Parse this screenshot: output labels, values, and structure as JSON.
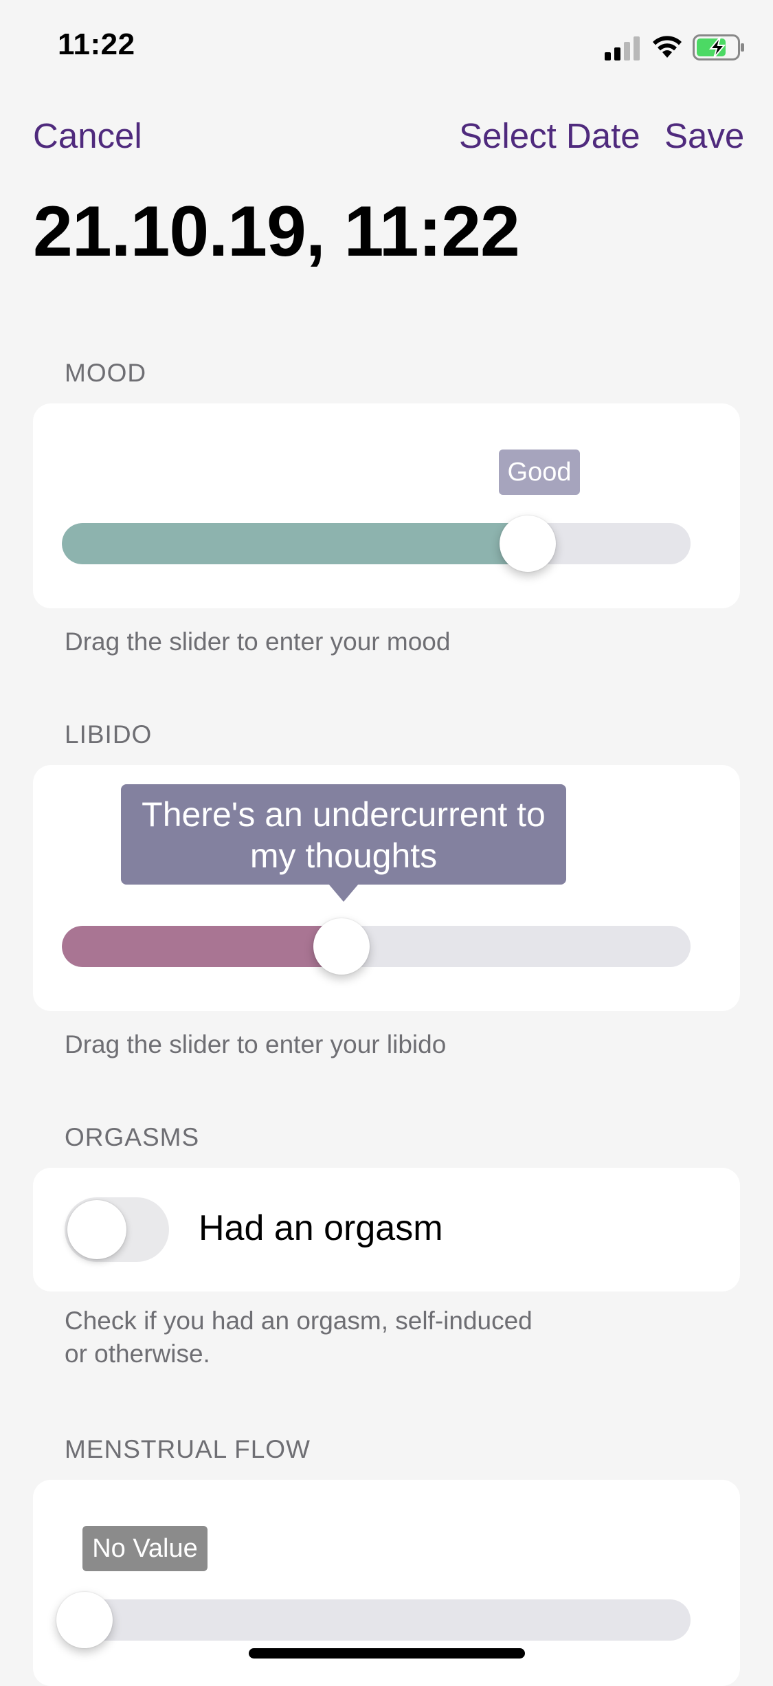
{
  "status_bar": {
    "time": "11:22"
  },
  "nav": {
    "cancel": "Cancel",
    "select_date": "Select Date",
    "save": "Save"
  },
  "entry": {
    "datetime": "21.10.19, 11:22"
  },
  "mood": {
    "section": "MOOD",
    "value_label": "Good",
    "level": 0.76,
    "fill_color": "#8db3ae",
    "help": "Drag the slider to enter your mood"
  },
  "libido": {
    "section": "LIBIDO",
    "value_label_line1": "There's an undercurrent to",
    "value_label_line2": "my thoughts",
    "level": 0.44,
    "fill_color": "#a97593",
    "help": "Drag the slider to enter your libido"
  },
  "orgasms": {
    "section": "ORGASMS",
    "toggle_label": "Had an orgasm",
    "toggle_on": false,
    "help_line1": "Check if you had an orgasm, self-induced",
    "help_line2": "or otherwise."
  },
  "menstrual_flow": {
    "section": "MENSTRUAL FLOW",
    "value_label": "No Value",
    "level": 0
  },
  "colors": {
    "accent": "#4f2a7d"
  }
}
